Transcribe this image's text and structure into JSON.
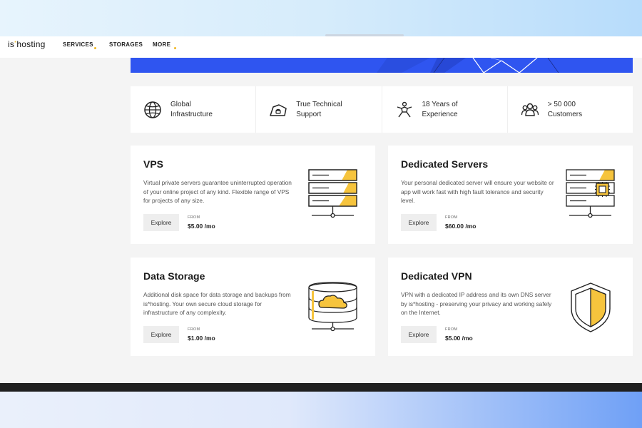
{
  "brand": {
    "logo_prefix": "is",
    "logo_star": "*",
    "logo_suffix": "hosting"
  },
  "nav": {
    "items": [
      {
        "label": "SERVICES",
        "has_dropdown": true
      },
      {
        "label": "STORAGES",
        "has_dropdown": false
      },
      {
        "label": "MORE",
        "has_dropdown": true
      }
    ]
  },
  "features": [
    {
      "icon": "globe-icon",
      "line1": "Global",
      "line2": "Infrastructure"
    },
    {
      "icon": "support-icon",
      "line1": "True Technical",
      "line2": "Support"
    },
    {
      "icon": "experience-icon",
      "line1": "18 Years of",
      "line2": "Experience"
    },
    {
      "icon": "customers-icon",
      "line1": "> 50 000",
      "line2": "Customers"
    }
  ],
  "cards": {
    "vps": {
      "title": "VPS",
      "description": "Virtual private servers guarantee uninterrupted operation of your online project of any kind. Flexible range of VPS for projects of any size.",
      "button": "Explore",
      "from": "FROM",
      "price": "$5.00 /mo"
    },
    "dedicated": {
      "title": "Dedicated Servers",
      "description": "Your personal dedicated server will ensure your website or app will work fast with high fault tolerance and security level.",
      "button": "Explore",
      "from": "FROM",
      "price": "$60.00 /mo"
    },
    "storage": {
      "title": "Data Storage",
      "description": "Additional disk space for data storage and backups from is*hosting. Your own secure cloud storage for infrastructure of any complexity.",
      "button": "Explore",
      "from": "FROM",
      "price": "$1.00 /mo"
    },
    "vpn": {
      "title": "Dedicated VPN",
      "description": "VPN with a dedicated IP address and its own DNS server by is*hosting - preserving your privacy and working safely on the Internet.",
      "button": "Explore",
      "from": "FROM",
      "price": "$5.00 /mo"
    }
  },
  "colors": {
    "accent": "#f0b823",
    "hero_blue": "#2f55f0",
    "text_dark": "#1d1d1d"
  }
}
